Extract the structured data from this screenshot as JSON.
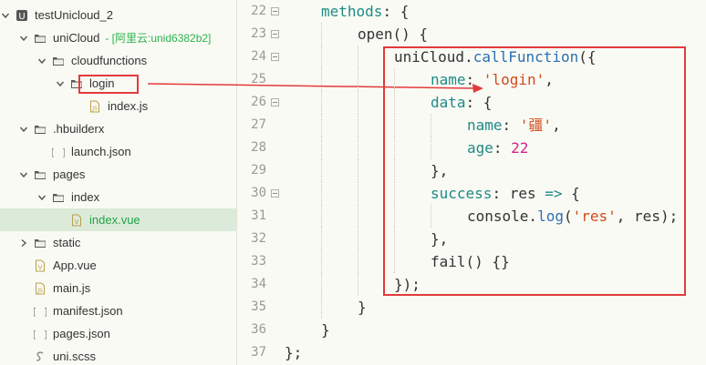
{
  "explorer": {
    "items": [
      {
        "label": "testUnicloud_2",
        "sub": "",
        "icon": "project-icon",
        "chevron": "down",
        "depth": 0,
        "selected": false
      },
      {
        "label": "uniCloud",
        "sub": "- [阿里云:unid6382b2]",
        "icon": "cloud-folder-icon",
        "chevron": "down",
        "depth": 1,
        "selected": false
      },
      {
        "label": "cloudfunctions",
        "sub": "",
        "icon": "folder-icon",
        "chevron": "down",
        "depth": 2,
        "selected": false
      },
      {
        "label": "login",
        "sub": "",
        "icon": "folder-icon",
        "chevron": "down",
        "depth": 3,
        "selected": false
      },
      {
        "label": "index.js",
        "sub": "",
        "icon": "js-file-icon",
        "chevron": "",
        "depth": 4,
        "selected": false
      },
      {
        "label": ".hbuilderx",
        "sub": "",
        "icon": "folder-icon",
        "chevron": "down",
        "depth": 1,
        "selected": false
      },
      {
        "label": "launch.json",
        "sub": "",
        "icon": "json-file-icon",
        "chevron": "",
        "depth": 2,
        "selected": false
      },
      {
        "label": "pages",
        "sub": "",
        "icon": "folder-icon",
        "chevron": "down",
        "depth": 1,
        "selected": false
      },
      {
        "label": "index",
        "sub": "",
        "icon": "folder-icon",
        "chevron": "down",
        "depth": 2,
        "selected": false
      },
      {
        "label": "index.vue",
        "sub": "",
        "icon": "vue-file-icon",
        "chevron": "",
        "depth": 3,
        "selected": true
      },
      {
        "label": "static",
        "sub": "",
        "icon": "folder-icon",
        "chevron": "right",
        "depth": 1,
        "selected": false
      },
      {
        "label": "App.vue",
        "sub": "",
        "icon": "vue-file-icon",
        "chevron": "",
        "depth": 1,
        "selected": false
      },
      {
        "label": "main.js",
        "sub": "",
        "icon": "js-file-icon",
        "chevron": "",
        "depth": 1,
        "selected": false
      },
      {
        "label": "manifest.json",
        "sub": "",
        "icon": "json-file-icon",
        "chevron": "",
        "depth": 1,
        "selected": false
      },
      {
        "label": "pages.json",
        "sub": "",
        "icon": "json-file-icon",
        "chevron": "",
        "depth": 1,
        "selected": false
      },
      {
        "label": "uni.scss",
        "sub": "",
        "icon": "scss-file-icon",
        "chevron": "",
        "depth": 1,
        "selected": false
      }
    ]
  },
  "editor": {
    "lines": [
      {
        "num": "22",
        "fold": true,
        "indent": 1,
        "tokens": [
          [
            "kw",
            "methods"
          ],
          [
            "punc",
            ": {"
          ]
        ]
      },
      {
        "num": "23",
        "fold": true,
        "indent": 2,
        "tokens": [
          [
            "punc",
            "open() {"
          ]
        ]
      },
      {
        "num": "24",
        "fold": true,
        "indent": 3,
        "tokens": [
          [
            "punc",
            "uniCloud."
          ],
          [
            "fn",
            "callFunction"
          ],
          [
            "punc",
            "({"
          ]
        ]
      },
      {
        "num": "25",
        "fold": false,
        "indent": 4,
        "tokens": [
          [
            "kw",
            "name"
          ],
          [
            "punc",
            ": "
          ],
          [
            "str",
            "'login'"
          ],
          [
            "punc",
            ","
          ]
        ]
      },
      {
        "num": "26",
        "fold": true,
        "indent": 4,
        "tokens": [
          [
            "kw",
            "data"
          ],
          [
            "punc",
            ": {"
          ]
        ]
      },
      {
        "num": "27",
        "fold": false,
        "indent": 5,
        "tokens": [
          [
            "kw",
            "name"
          ],
          [
            "punc",
            ": "
          ],
          [
            "str",
            "'疆'"
          ],
          [
            "punc",
            ","
          ]
        ]
      },
      {
        "num": "28",
        "fold": false,
        "indent": 5,
        "tokens": [
          [
            "kw",
            "age"
          ],
          [
            "punc",
            ": "
          ],
          [
            "num",
            "22"
          ]
        ]
      },
      {
        "num": "29",
        "fold": false,
        "indent": 4,
        "tokens": [
          [
            "punc",
            "},"
          ]
        ]
      },
      {
        "num": "30",
        "fold": true,
        "indent": 4,
        "tokens": [
          [
            "kw",
            "success"
          ],
          [
            "punc",
            ": res "
          ],
          [
            "kw",
            "=>"
          ],
          [
            "punc",
            " {"
          ]
        ]
      },
      {
        "num": "31",
        "fold": false,
        "indent": 5,
        "tokens": [
          [
            "punc",
            "console."
          ],
          [
            "fn",
            "log"
          ],
          [
            "punc",
            "("
          ],
          [
            "str",
            "'res'"
          ],
          [
            "punc",
            ", res);"
          ]
        ]
      },
      {
        "num": "32",
        "fold": false,
        "indent": 4,
        "tokens": [
          [
            "punc",
            "},"
          ]
        ]
      },
      {
        "num": "33",
        "fold": false,
        "indent": 4,
        "tokens": [
          [
            "punc",
            "fail() {}"
          ]
        ]
      },
      {
        "num": "34",
        "fold": false,
        "indent": 3,
        "tokens": [
          [
            "punc",
            "});"
          ]
        ]
      },
      {
        "num": "35",
        "fold": false,
        "indent": 2,
        "tokens": [
          [
            "punc",
            "}"
          ]
        ]
      },
      {
        "num": "36",
        "fold": false,
        "indent": 1,
        "tokens": [
          [
            "punc",
            "}"
          ]
        ]
      },
      {
        "num": "37",
        "fold": false,
        "indent": 0,
        "tokens": [
          [
            "punc",
            "};"
          ]
        ]
      }
    ]
  },
  "colors": {
    "highlight": "#e23b3b",
    "selected_bg": "#dcebd9",
    "selected_text": "#22a24a"
  }
}
